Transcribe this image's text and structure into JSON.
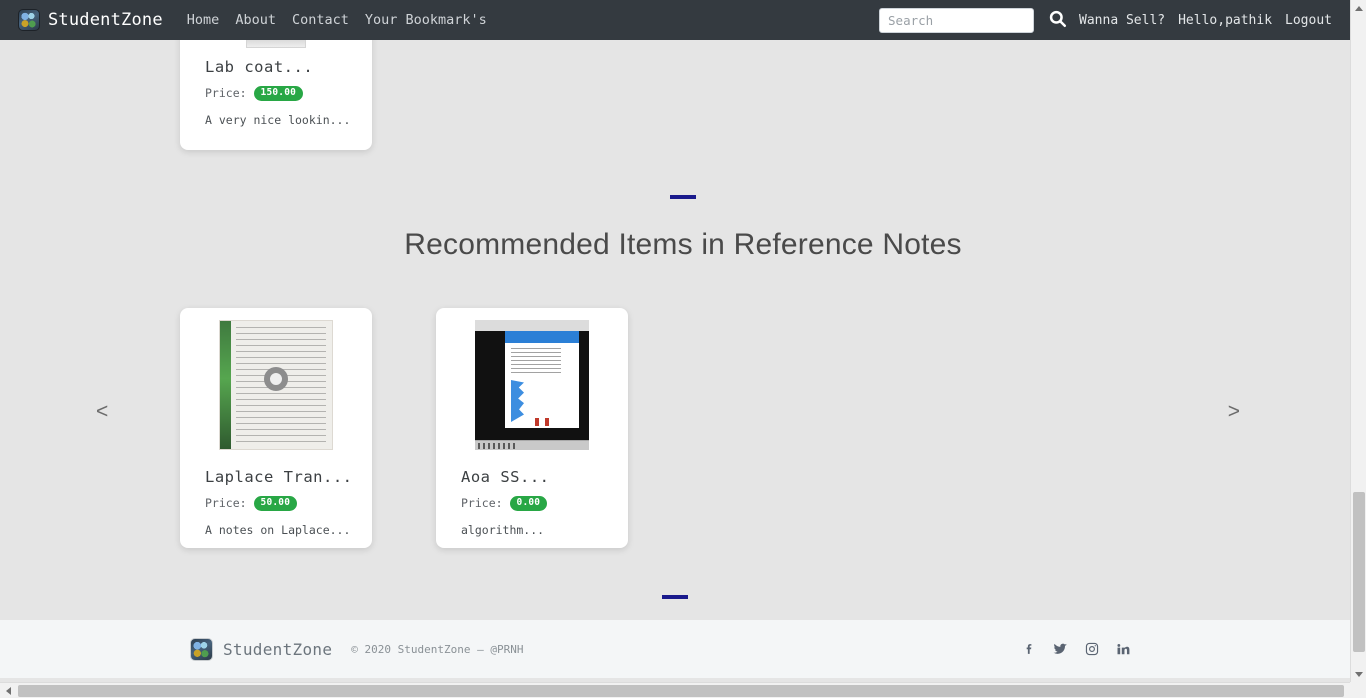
{
  "navbar": {
    "brand": "StudentZone",
    "logo_icon": "studentzone-logo-icon",
    "links": [
      {
        "label": "Home"
      },
      {
        "label": "About"
      },
      {
        "label": "Contact"
      },
      {
        "label": "Your Bookmark's"
      }
    ],
    "search": {
      "placeholder": "Search",
      "value": "",
      "icon": "search-icon"
    },
    "right_links": [
      {
        "label": "Wanna Sell?"
      },
      {
        "label": "Hello,pathik"
      },
      {
        "label": "Logout"
      }
    ],
    "background_color": "#343a40"
  },
  "top_card": {
    "title": "Lab coat...",
    "price_label": "Price:",
    "price": "150.00",
    "description": "A very nice lookin..."
  },
  "section": {
    "title": "Recommended Items in Reference Notes",
    "divider_color": "#1a1a8c",
    "prev_arrow": "<",
    "next_arrow": ">",
    "items": [
      {
        "title": "Laplace Tran...",
        "price_label": "Price:",
        "price": "50.00",
        "description": "A notes on Laplace...",
        "thumb": "scanned-notes-photo"
      },
      {
        "title": "Aoa SS...",
        "price_label": "Price:",
        "price": "0.00",
        "description": "algorithm...",
        "thumb": "screenshot-photo"
      }
    ]
  },
  "footer": {
    "brand": "StudentZone",
    "logo_icon": "studentzone-logo-icon",
    "copyright": "© 2020 StudentZone — @PRNH",
    "social": [
      {
        "name": "facebook-icon"
      },
      {
        "name": "twitter-icon"
      },
      {
        "name": "instagram-icon"
      },
      {
        "name": "linkedin-icon"
      }
    ],
    "background_color": "#f4f6f7"
  },
  "colors": {
    "page_background": "#e5e5e5",
    "price_badge": "#28a745",
    "navbar": "#343a40",
    "accent": "#1a1a8c"
  }
}
